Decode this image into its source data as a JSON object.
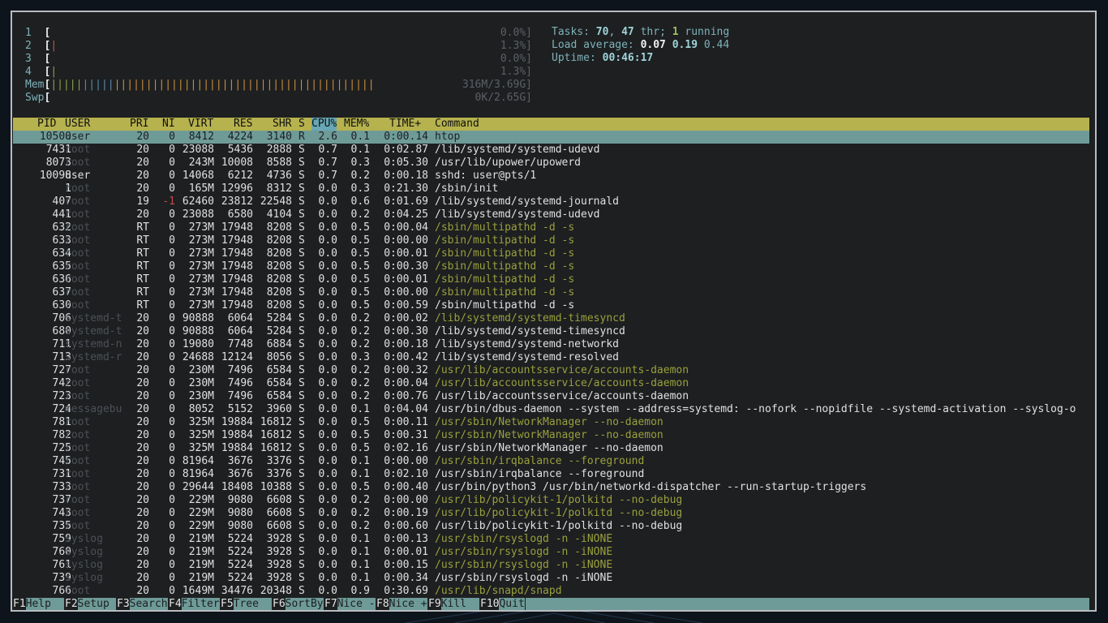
{
  "cpus": [
    {
      "num": "1",
      "pct": "0.0%]",
      "ticks": []
    },
    {
      "num": "2",
      "pct": "1.3%]",
      "ticks": [
        "r"
      ]
    },
    {
      "num": "3",
      "pct": "0.0%]",
      "ticks": []
    },
    {
      "num": "4",
      "pct": "1.3%]",
      "ticks": [
        "g"
      ]
    }
  ],
  "mem": {
    "label": "Mem",
    "value": "316M/3.69G]",
    "ticks": "gggggbbbbbooooooooooooooooooooooooooooooooooooooooo"
  },
  "swp": {
    "label": "Swp",
    "value": "0K/2.65G]"
  },
  "stats": {
    "tasks_label": "Tasks: ",
    "tasks": "70",
    "sep1": ", ",
    "thr": "47",
    "thr_label": " thr; ",
    "running": "1",
    "running_label": " running",
    "load_label": "Load average: ",
    "load1": "0.07",
    "load5": "0.19",
    "load15": "0.44",
    "uptime_label": "Uptime: ",
    "uptime": "00:46:17"
  },
  "header": {
    "pid": "PID",
    "user": "USER",
    "pri": "PRI",
    "ni": "NI",
    "virt": "VIRT",
    "res": "RES",
    "shr": "SHR",
    "s": "S",
    "cpu": "CPU%",
    "mem": "MEM%",
    "time": "TIME+",
    "command": "Command"
  },
  "processes": [
    {
      "pid": "10500",
      "user": "user",
      "pri": "20",
      "ni": "0",
      "virt": "8412",
      "res": "4224",
      "shr": "3140",
      "s": "R",
      "cpu": "2.6",
      "mem": "0.1",
      "time": "0:00.14",
      "cmd": "htop",
      "thread": false,
      "sel": true
    },
    {
      "pid": "7431",
      "user": "root",
      "pri": "20",
      "ni": "0",
      "virt": "23088",
      "res": "5436",
      "shr": "2888",
      "s": "S",
      "cpu": "0.7",
      "mem": "0.1",
      "time": "0:02.87",
      "cmd": "/lib/systemd/systemd-udevd",
      "thread": false
    },
    {
      "pid": "8073",
      "user": "root",
      "pri": "20",
      "ni": "0",
      "virt": "243M",
      "res": "10008",
      "shr": "8588",
      "s": "S",
      "cpu": "0.7",
      "mem": "0.3",
      "time": "0:05.30",
      "cmd": "/usr/lib/upower/upowerd",
      "thread": false
    },
    {
      "pid": "10098",
      "user": "user",
      "pri": "20",
      "ni": "0",
      "virt": "14068",
      "res": "6212",
      "shr": "4736",
      "s": "S",
      "cpu": "0.7",
      "mem": "0.2",
      "time": "0:00.18",
      "cmd": "sshd: user@pts/1",
      "thread": false
    },
    {
      "pid": "1",
      "user": "root",
      "pri": "20",
      "ni": "0",
      "virt": "165M",
      "res": "12996",
      "shr": "8312",
      "s": "S",
      "cpu": "0.0",
      "mem": "0.3",
      "time": "0:21.30",
      "cmd": "/sbin/init",
      "thread": false
    },
    {
      "pid": "407",
      "user": "root",
      "pri": "19",
      "ni": "-1",
      "virt": "62460",
      "res": "23812",
      "shr": "22548",
      "s": "S",
      "cpu": "0.0",
      "mem": "0.6",
      "time": "0:01.69",
      "cmd": "/lib/systemd/systemd-journald",
      "thread": false
    },
    {
      "pid": "441",
      "user": "root",
      "pri": "20",
      "ni": "0",
      "virt": "23088",
      "res": "6580",
      "shr": "4104",
      "s": "S",
      "cpu": "0.0",
      "mem": "0.2",
      "time": "0:04.25",
      "cmd": "/lib/systemd/systemd-udevd",
      "thread": false
    },
    {
      "pid": "632",
      "user": "root",
      "pri": "RT",
      "ni": "0",
      "virt": "273M",
      "res": "17948",
      "shr": "8208",
      "s": "S",
      "cpu": "0.0",
      "mem": "0.5",
      "time": "0:00.04",
      "cmd": "/sbin/multipathd -d -s",
      "thread": true
    },
    {
      "pid": "633",
      "user": "root",
      "pri": "RT",
      "ni": "0",
      "virt": "273M",
      "res": "17948",
      "shr": "8208",
      "s": "S",
      "cpu": "0.0",
      "mem": "0.5",
      "time": "0:00.00",
      "cmd": "/sbin/multipathd -d -s",
      "thread": true
    },
    {
      "pid": "634",
      "user": "root",
      "pri": "RT",
      "ni": "0",
      "virt": "273M",
      "res": "17948",
      "shr": "8208",
      "s": "S",
      "cpu": "0.0",
      "mem": "0.5",
      "time": "0:00.01",
      "cmd": "/sbin/multipathd -d -s",
      "thread": true
    },
    {
      "pid": "635",
      "user": "root",
      "pri": "RT",
      "ni": "0",
      "virt": "273M",
      "res": "17948",
      "shr": "8208",
      "s": "S",
      "cpu": "0.0",
      "mem": "0.5",
      "time": "0:00.30",
      "cmd": "/sbin/multipathd -d -s",
      "thread": true
    },
    {
      "pid": "636",
      "user": "root",
      "pri": "RT",
      "ni": "0",
      "virt": "273M",
      "res": "17948",
      "shr": "8208",
      "s": "S",
      "cpu": "0.0",
      "mem": "0.5",
      "time": "0:00.01",
      "cmd": "/sbin/multipathd -d -s",
      "thread": true
    },
    {
      "pid": "637",
      "user": "root",
      "pri": "RT",
      "ni": "0",
      "virt": "273M",
      "res": "17948",
      "shr": "8208",
      "s": "S",
      "cpu": "0.0",
      "mem": "0.5",
      "time": "0:00.00",
      "cmd": "/sbin/multipathd -d -s",
      "thread": true
    },
    {
      "pid": "630",
      "user": "root",
      "pri": "RT",
      "ni": "0",
      "virt": "273M",
      "res": "17948",
      "shr": "8208",
      "s": "S",
      "cpu": "0.0",
      "mem": "0.5",
      "time": "0:00.59",
      "cmd": "/sbin/multipathd -d -s",
      "thread": false
    },
    {
      "pid": "706",
      "user": "systemd-t",
      "pri": "20",
      "ni": "0",
      "virt": "90888",
      "res": "6064",
      "shr": "5284",
      "s": "S",
      "cpu": "0.0",
      "mem": "0.2",
      "time": "0:00.02",
      "cmd": "/lib/systemd/systemd-timesyncd",
      "thread": true
    },
    {
      "pid": "680",
      "user": "systemd-t",
      "pri": "20",
      "ni": "0",
      "virt": "90888",
      "res": "6064",
      "shr": "5284",
      "s": "S",
      "cpu": "0.0",
      "mem": "0.2",
      "time": "0:00.30",
      "cmd": "/lib/systemd/systemd-timesyncd",
      "thread": false
    },
    {
      "pid": "711",
      "user": "systemd-n",
      "pri": "20",
      "ni": "0",
      "virt": "19080",
      "res": "7748",
      "shr": "6884",
      "s": "S",
      "cpu": "0.0",
      "mem": "0.2",
      "time": "0:00.18",
      "cmd": "/lib/systemd/systemd-networkd",
      "thread": false
    },
    {
      "pid": "713",
      "user": "systemd-r",
      "pri": "20",
      "ni": "0",
      "virt": "24688",
      "res": "12124",
      "shr": "8056",
      "s": "S",
      "cpu": "0.0",
      "mem": "0.3",
      "time": "0:00.42",
      "cmd": "/lib/systemd/systemd-resolved",
      "thread": false
    },
    {
      "pid": "727",
      "user": "root",
      "pri": "20",
      "ni": "0",
      "virt": "230M",
      "res": "7496",
      "shr": "6584",
      "s": "S",
      "cpu": "0.0",
      "mem": "0.2",
      "time": "0:00.32",
      "cmd": "/usr/lib/accountsservice/accounts-daemon",
      "thread": true
    },
    {
      "pid": "742",
      "user": "root",
      "pri": "20",
      "ni": "0",
      "virt": "230M",
      "res": "7496",
      "shr": "6584",
      "s": "S",
      "cpu": "0.0",
      "mem": "0.2",
      "time": "0:00.04",
      "cmd": "/usr/lib/accountsservice/accounts-daemon",
      "thread": true
    },
    {
      "pid": "723",
      "user": "root",
      "pri": "20",
      "ni": "0",
      "virt": "230M",
      "res": "7496",
      "shr": "6584",
      "s": "S",
      "cpu": "0.0",
      "mem": "0.2",
      "time": "0:00.76",
      "cmd": "/usr/lib/accountsservice/accounts-daemon",
      "thread": false
    },
    {
      "pid": "724",
      "user": "messagebu",
      "pri": "20",
      "ni": "0",
      "virt": "8052",
      "res": "5152",
      "shr": "3960",
      "s": "S",
      "cpu": "0.0",
      "mem": "0.1",
      "time": "0:04.04",
      "cmd": "/usr/bin/dbus-daemon --system --address=systemd: --nofork --nopidfile --systemd-activation --syslog-o",
      "thread": false
    },
    {
      "pid": "781",
      "user": "root",
      "pri": "20",
      "ni": "0",
      "virt": "325M",
      "res": "19884",
      "shr": "16812",
      "s": "S",
      "cpu": "0.0",
      "mem": "0.5",
      "time": "0:00.11",
      "cmd": "/usr/sbin/NetworkManager --no-daemon",
      "thread": true
    },
    {
      "pid": "782",
      "user": "root",
      "pri": "20",
      "ni": "0",
      "virt": "325M",
      "res": "19884",
      "shr": "16812",
      "s": "S",
      "cpu": "0.0",
      "mem": "0.5",
      "time": "0:00.31",
      "cmd": "/usr/sbin/NetworkManager --no-daemon",
      "thread": true
    },
    {
      "pid": "725",
      "user": "root",
      "pri": "20",
      "ni": "0",
      "virt": "325M",
      "res": "19884",
      "shr": "16812",
      "s": "S",
      "cpu": "0.0",
      "mem": "0.5",
      "time": "0:02.16",
      "cmd": "/usr/sbin/NetworkManager --no-daemon",
      "thread": false
    },
    {
      "pid": "745",
      "user": "root",
      "pri": "20",
      "ni": "0",
      "virt": "81964",
      "res": "3676",
      "shr": "3376",
      "s": "S",
      "cpu": "0.0",
      "mem": "0.1",
      "time": "0:00.00",
      "cmd": "/usr/sbin/irqbalance --foreground",
      "thread": true
    },
    {
      "pid": "731",
      "user": "root",
      "pri": "20",
      "ni": "0",
      "virt": "81964",
      "res": "3676",
      "shr": "3376",
      "s": "S",
      "cpu": "0.0",
      "mem": "0.1",
      "time": "0:02.10",
      "cmd": "/usr/sbin/irqbalance --foreground",
      "thread": false
    },
    {
      "pid": "733",
      "user": "root",
      "pri": "20",
      "ni": "0",
      "virt": "29644",
      "res": "18408",
      "shr": "10388",
      "s": "S",
      "cpu": "0.0",
      "mem": "0.5",
      "time": "0:00.40",
      "cmd": "/usr/bin/python3 /usr/bin/networkd-dispatcher --run-startup-triggers",
      "thread": false
    },
    {
      "pid": "737",
      "user": "root",
      "pri": "20",
      "ni": "0",
      "virt": "229M",
      "res": "9080",
      "shr": "6608",
      "s": "S",
      "cpu": "0.0",
      "mem": "0.2",
      "time": "0:00.00",
      "cmd": "/usr/lib/policykit-1/polkitd --no-debug",
      "thread": true
    },
    {
      "pid": "743",
      "user": "root",
      "pri": "20",
      "ni": "0",
      "virt": "229M",
      "res": "9080",
      "shr": "6608",
      "s": "S",
      "cpu": "0.0",
      "mem": "0.2",
      "time": "0:00.19",
      "cmd": "/usr/lib/policykit-1/polkitd --no-debug",
      "thread": true
    },
    {
      "pid": "735",
      "user": "root",
      "pri": "20",
      "ni": "0",
      "virt": "229M",
      "res": "9080",
      "shr": "6608",
      "s": "S",
      "cpu": "0.0",
      "mem": "0.2",
      "time": "0:00.60",
      "cmd": "/usr/lib/policykit-1/polkitd --no-debug",
      "thread": false
    },
    {
      "pid": "759",
      "user": "syslog",
      "pri": "20",
      "ni": "0",
      "virt": "219M",
      "res": "5224",
      "shr": "3928",
      "s": "S",
      "cpu": "0.0",
      "mem": "0.1",
      "time": "0:00.13",
      "cmd": "/usr/sbin/rsyslogd -n -iNONE",
      "thread": true
    },
    {
      "pid": "760",
      "user": "syslog",
      "pri": "20",
      "ni": "0",
      "virt": "219M",
      "res": "5224",
      "shr": "3928",
      "s": "S",
      "cpu": "0.0",
      "mem": "0.1",
      "time": "0:00.01",
      "cmd": "/usr/sbin/rsyslogd -n -iNONE",
      "thread": true
    },
    {
      "pid": "761",
      "user": "syslog",
      "pri": "20",
      "ni": "0",
      "virt": "219M",
      "res": "5224",
      "shr": "3928",
      "s": "S",
      "cpu": "0.0",
      "mem": "0.1",
      "time": "0:00.15",
      "cmd": "/usr/sbin/rsyslogd -n -iNONE",
      "thread": true
    },
    {
      "pid": "739",
      "user": "syslog",
      "pri": "20",
      "ni": "0",
      "virt": "219M",
      "res": "5224",
      "shr": "3928",
      "s": "S",
      "cpu": "0.0",
      "mem": "0.1",
      "time": "0:00.34",
      "cmd": "/usr/sbin/rsyslogd -n -iNONE",
      "thread": false
    },
    {
      "pid": "766",
      "user": "root",
      "pri": "20",
      "ni": "0",
      "virt": "1649M",
      "res": "34476",
      "shr": "20348",
      "s": "S",
      "cpu": "0.0",
      "mem": "0.9",
      "time": "0:30.69",
      "cmd": "/usr/lib/snapd/snapd",
      "thread": true
    }
  ],
  "footer": [
    {
      "key": "F1",
      "label": "Help  "
    },
    {
      "key": "F2",
      "label": "Setup "
    },
    {
      "key": "F3",
      "label": "Search"
    },
    {
      "key": "F4",
      "label": "Filter"
    },
    {
      "key": "F5",
      "label": "Tree  "
    },
    {
      "key": "F6",
      "label": "SortBy"
    },
    {
      "key": "F7",
      "label": "Nice -"
    },
    {
      "key": "F8",
      "label": "Nice +"
    },
    {
      "key": "F9",
      "label": "Kill  "
    },
    {
      "key": "F10",
      "label": "Quit"
    }
  ],
  "colors": {
    "header": "#b6b24e",
    "selected": "#6e9b98",
    "sorted": "#68a7b5",
    "thread": "#9aa03c"
  }
}
